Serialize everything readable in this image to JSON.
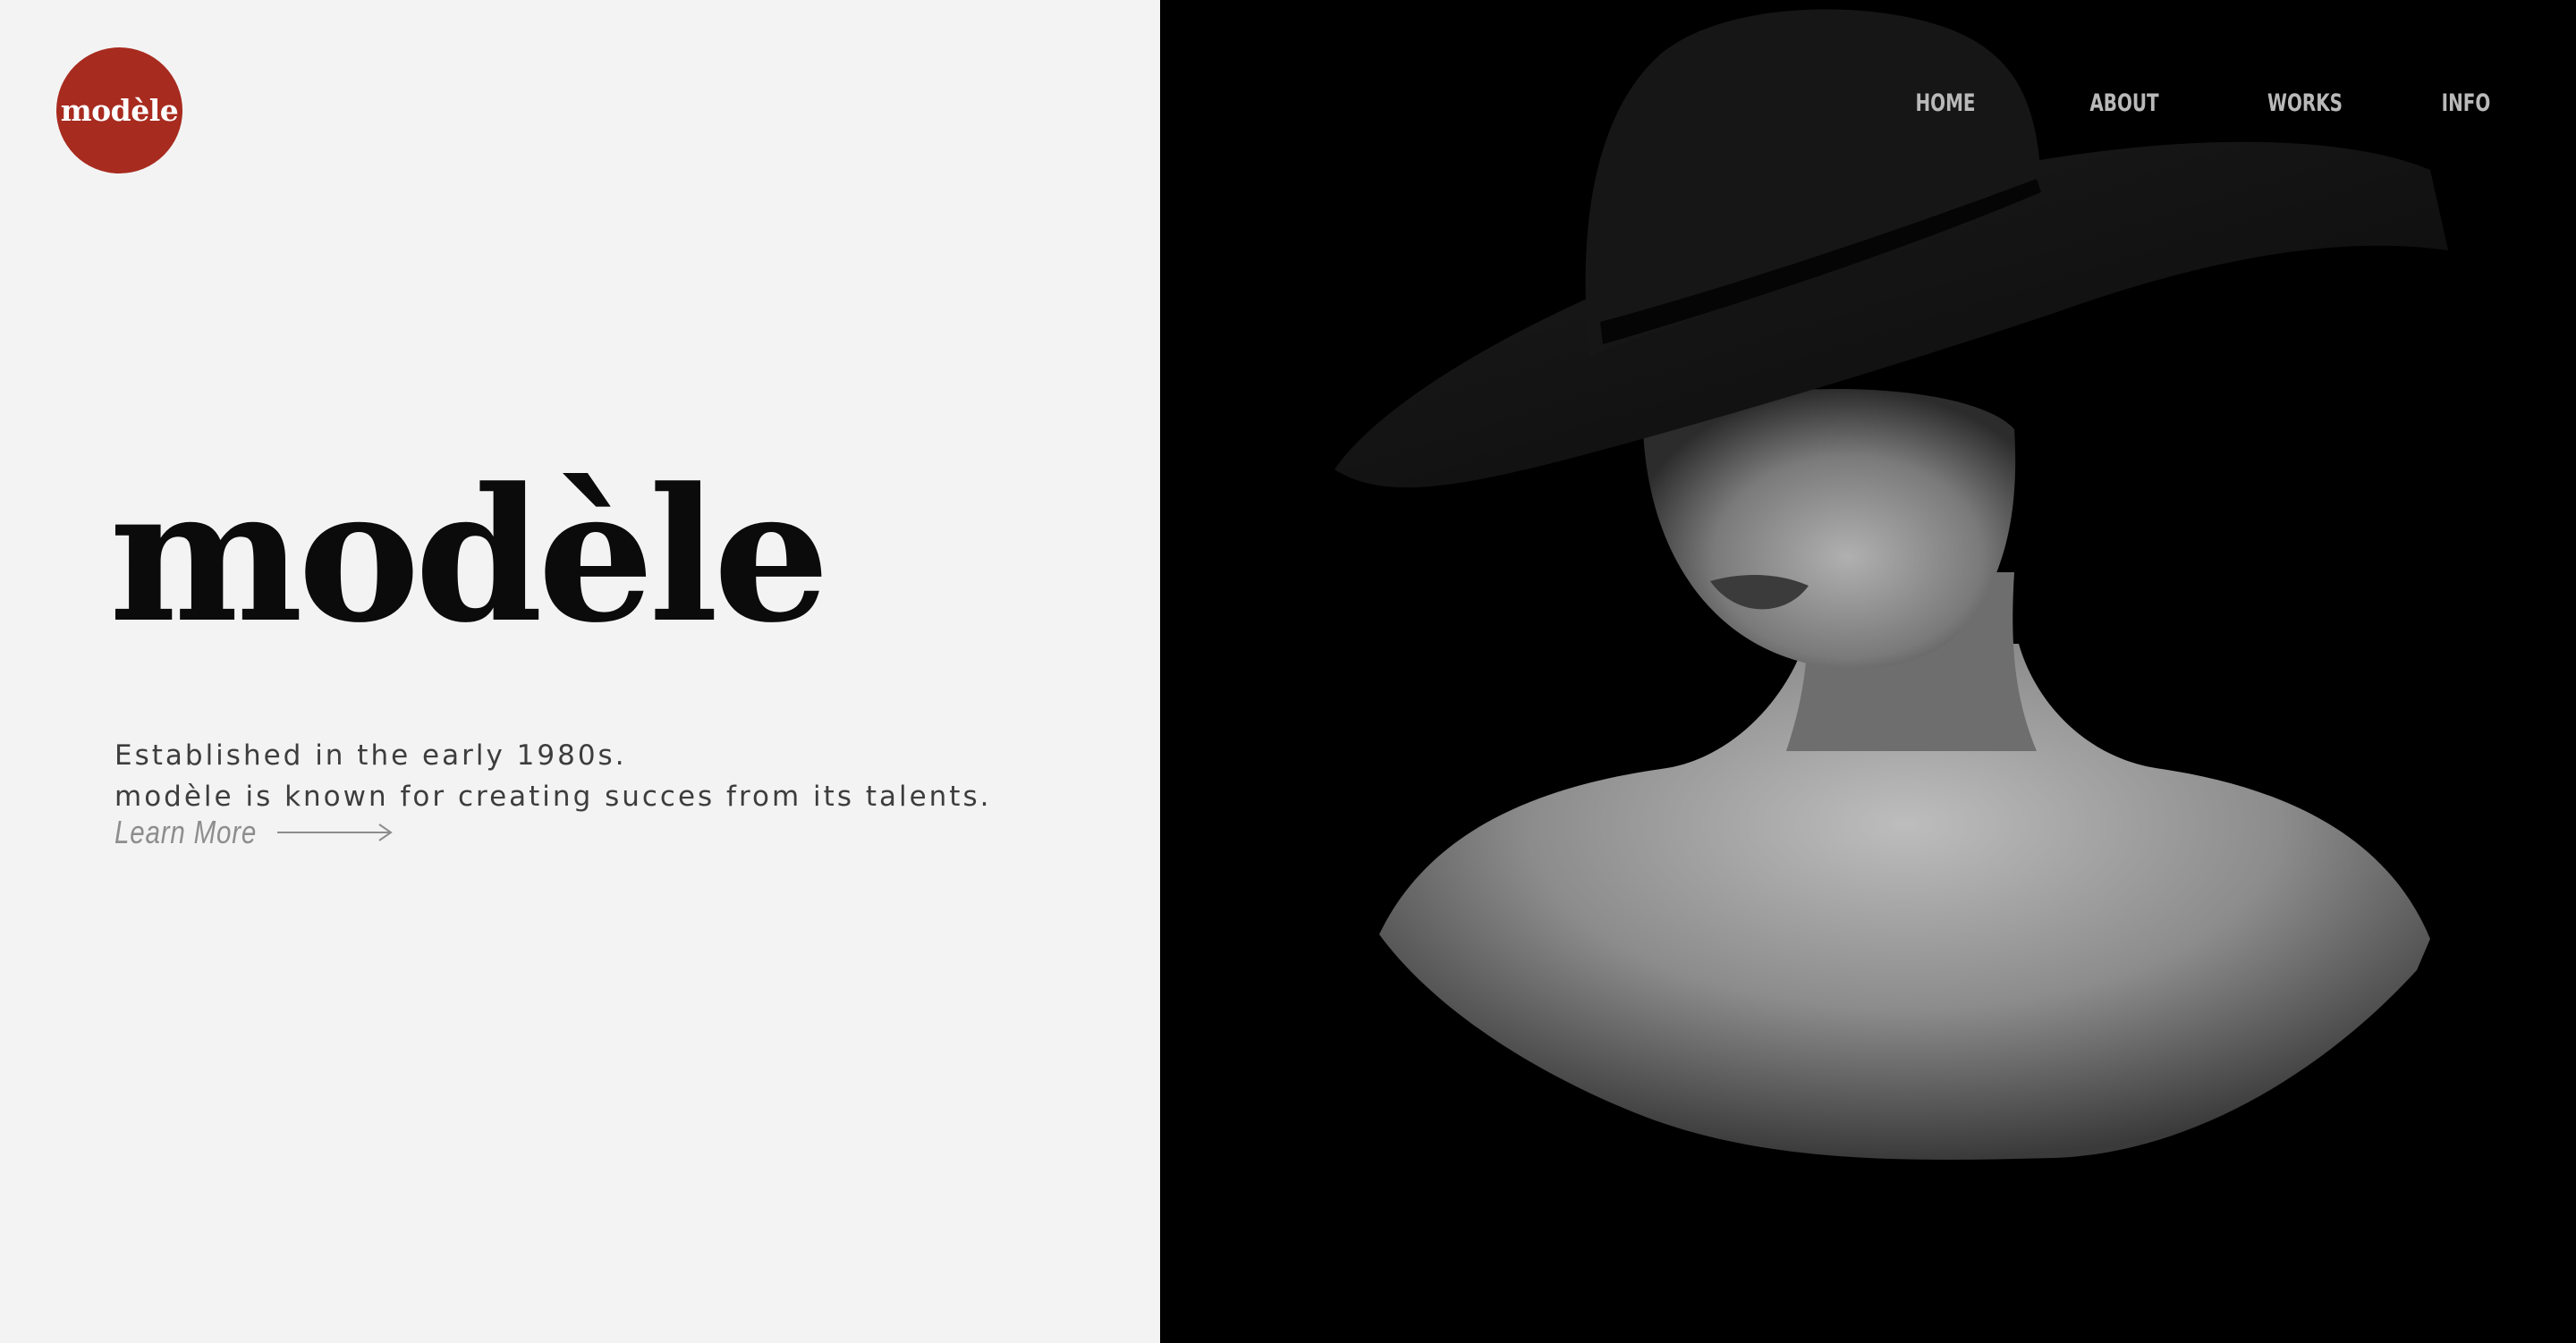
{
  "brand": {
    "logo_text": "modèle",
    "logo_color": "#a82b1f"
  },
  "hero": {
    "title": "modèle",
    "tagline_line1": "Established in the early 1980s.",
    "tagline_line2": "modèle is known for creating succes from its talents.",
    "cta_label": "Learn More",
    "cta_icon": "arrow-right-icon"
  },
  "nav": {
    "items": [
      {
        "label": "HOME"
      },
      {
        "label": "ABOUT"
      },
      {
        "label": "WORKS"
      },
      {
        "label": "INFO"
      }
    ]
  },
  "colors": {
    "left_background": "#f3f3f3",
    "right_background": "#000000",
    "title_color": "#0b0b0b",
    "nav_color": "#b9b9b9"
  },
  "image": {
    "subject": "black-and-white portrait of a woman in a wide-brim black hat"
  }
}
